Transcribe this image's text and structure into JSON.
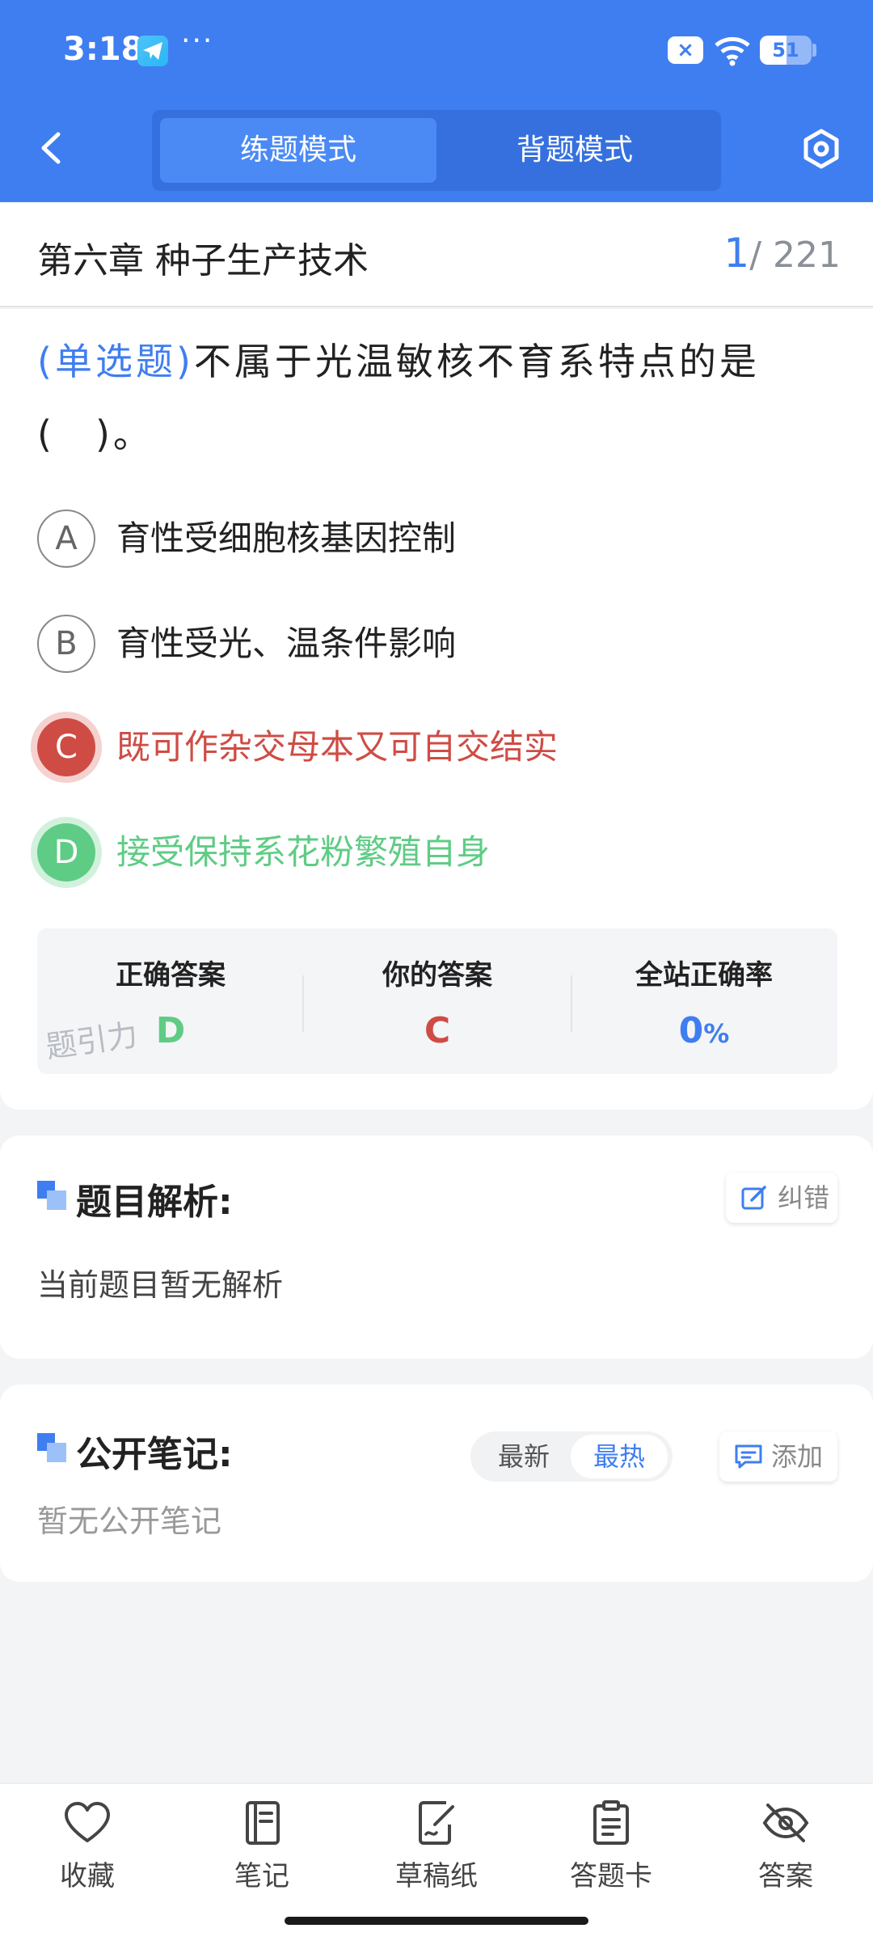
{
  "status_bar": {
    "time": "3:18",
    "dots": "···",
    "close_icon": "×",
    "battery": "51",
    "battery_level": 0.51
  },
  "nav": {
    "mode_practice": "练题模式",
    "mode_recite": "背题模式"
  },
  "chapter": {
    "title": "第六章 种子生产技术",
    "current": "1",
    "total": "/ 221"
  },
  "question": {
    "type_label": "(单选题)",
    "text": "不属于光温敏核不育系特点的是(　)。",
    "options": [
      {
        "letter": "A",
        "text": "育性受细胞核基因控制",
        "state": "normal"
      },
      {
        "letter": "B",
        "text": "育性受光、温条件影响",
        "state": "normal"
      },
      {
        "letter": "C",
        "text": "既可作杂交母本又可自交结实",
        "state": "wrong"
      },
      {
        "letter": "D",
        "text": "接受保持系花粉繁殖自身",
        "state": "correct"
      }
    ]
  },
  "stats": {
    "correct_label": "正确答案",
    "correct_value": "D",
    "yours_label": "你的答案",
    "yours_value": "C",
    "rate_label": "全站正确率",
    "rate_value": "0",
    "rate_unit": "%",
    "watermark": "题引力"
  },
  "analysis": {
    "title": "题目解析:",
    "report_button": "纠错",
    "body": "当前题目暂无解析"
  },
  "notes": {
    "title": "公开笔记:",
    "sort_newest": "最新",
    "sort_hottest": "最热",
    "add_button": "添加",
    "body": "暂无公开笔记"
  },
  "bottom_bar": {
    "favorite": "收藏",
    "notes": "笔记",
    "scratch": "草稿纸",
    "answer_sheet": "答题卡",
    "answer": "答案"
  },
  "colors": {
    "primary": "#3f7ef0",
    "wrong": "#cf4c45",
    "correct": "#5fcc85"
  }
}
